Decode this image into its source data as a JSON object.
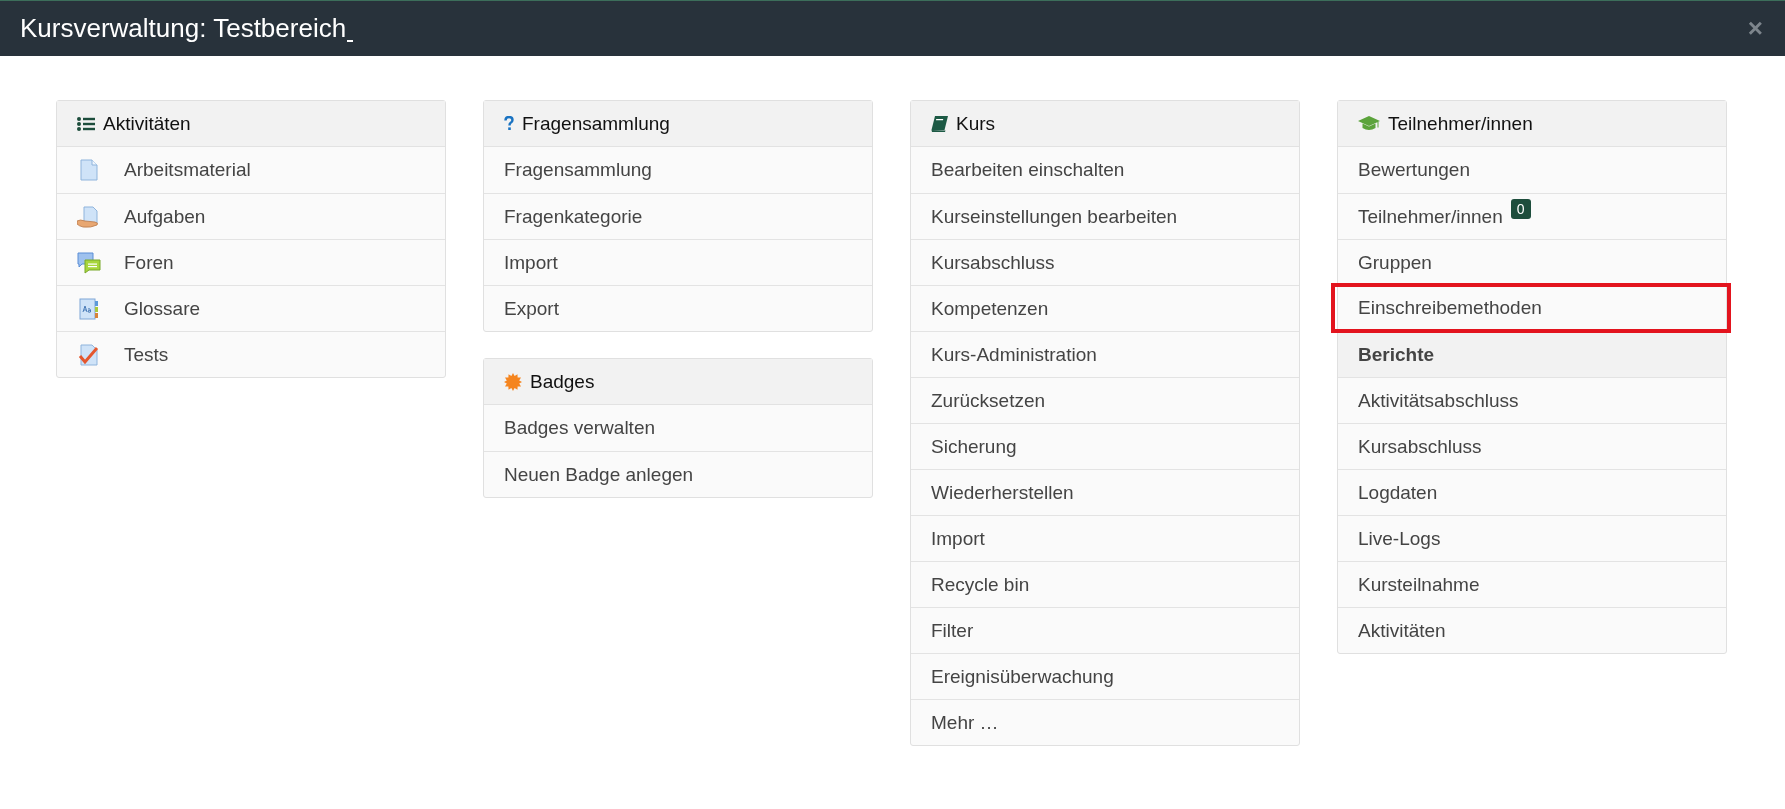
{
  "window": {
    "title": "Kursverwaltung: Testbereich",
    "close": "×"
  },
  "columns": [
    [
      {
        "title": "Aktivitäten",
        "items": [
          {
            "label": "Arbeitsmaterial",
            "kind": "link",
            "highlighted": false
          },
          {
            "label": "Aufgaben",
            "kind": "link",
            "highlighted": false
          },
          {
            "label": "Foren",
            "kind": "link",
            "highlighted": false
          },
          {
            "label": "Glossare",
            "kind": "link",
            "highlighted": false
          },
          {
            "label": "Tests",
            "kind": "link",
            "highlighted": false
          }
        ]
      }
    ],
    [
      {
        "title": "Fragensammlung",
        "items": [
          {
            "label": "Fragensammlung",
            "kind": "link",
            "highlighted": false
          },
          {
            "label": "Fragenkategorie",
            "kind": "link",
            "highlighted": false
          },
          {
            "label": "Import",
            "kind": "link",
            "highlighted": false
          },
          {
            "label": "Export",
            "kind": "link",
            "highlighted": false
          }
        ]
      },
      {
        "title": "Badges",
        "items": [
          {
            "label": "Badges verwalten",
            "kind": "link",
            "highlighted": false
          },
          {
            "label": "Neuen Badge anlegen",
            "kind": "link",
            "highlighted": false
          }
        ]
      }
    ],
    [
      {
        "title": "Kurs",
        "items": [
          {
            "label": "Bearbeiten einschalten",
            "kind": "link",
            "highlighted": false
          },
          {
            "label": "Kurseinstellungen bearbeiten",
            "kind": "link",
            "highlighted": false
          },
          {
            "label": "Kursabschluss",
            "kind": "link",
            "highlighted": false
          },
          {
            "label": "Kompetenzen",
            "kind": "link",
            "highlighted": false
          },
          {
            "label": "Kurs-Administration",
            "kind": "link",
            "highlighted": false
          },
          {
            "label": "Zurücksetzen",
            "kind": "link",
            "highlighted": false
          },
          {
            "label": "Sicherung",
            "kind": "link",
            "highlighted": false
          },
          {
            "label": "Wiederherstellen",
            "kind": "link",
            "highlighted": false
          },
          {
            "label": "Import",
            "kind": "link",
            "highlighted": false
          },
          {
            "label": "Recycle bin",
            "kind": "link",
            "highlighted": false
          },
          {
            "label": "Filter",
            "kind": "link",
            "highlighted": false
          },
          {
            "label": "Ereignisüberwachung",
            "kind": "link",
            "highlighted": false
          },
          {
            "label": "Mehr …",
            "kind": "link",
            "highlighted": false
          }
        ]
      }
    ],
    [
      {
        "title": "Teilnehmer/innen",
        "items": [
          {
            "label": "Bewertungen",
            "kind": "link",
            "highlighted": false
          },
          {
            "label": "Teilnehmer/innen",
            "kind": "link",
            "badge": "0",
            "highlighted": false
          },
          {
            "label": "Gruppen",
            "kind": "link",
            "highlighted": false
          },
          {
            "label": "Einschreibemethoden",
            "kind": "link",
            "highlighted": true
          },
          {
            "label": "Berichte",
            "kind": "subheading",
            "highlighted": false
          },
          {
            "label": "Aktivitätsabschluss",
            "kind": "link",
            "highlighted": false
          },
          {
            "label": "Kursabschluss",
            "kind": "link",
            "highlighted": false
          },
          {
            "label": "Logdaten",
            "kind": "link",
            "highlighted": false
          },
          {
            "label": "Live-Logs",
            "kind": "link",
            "highlighted": false
          },
          {
            "label": "Kursteilnahme",
            "kind": "link",
            "highlighted": false
          },
          {
            "label": "Aktivitäten",
            "kind": "link",
            "highlighted": false
          }
        ]
      }
    ]
  ]
}
